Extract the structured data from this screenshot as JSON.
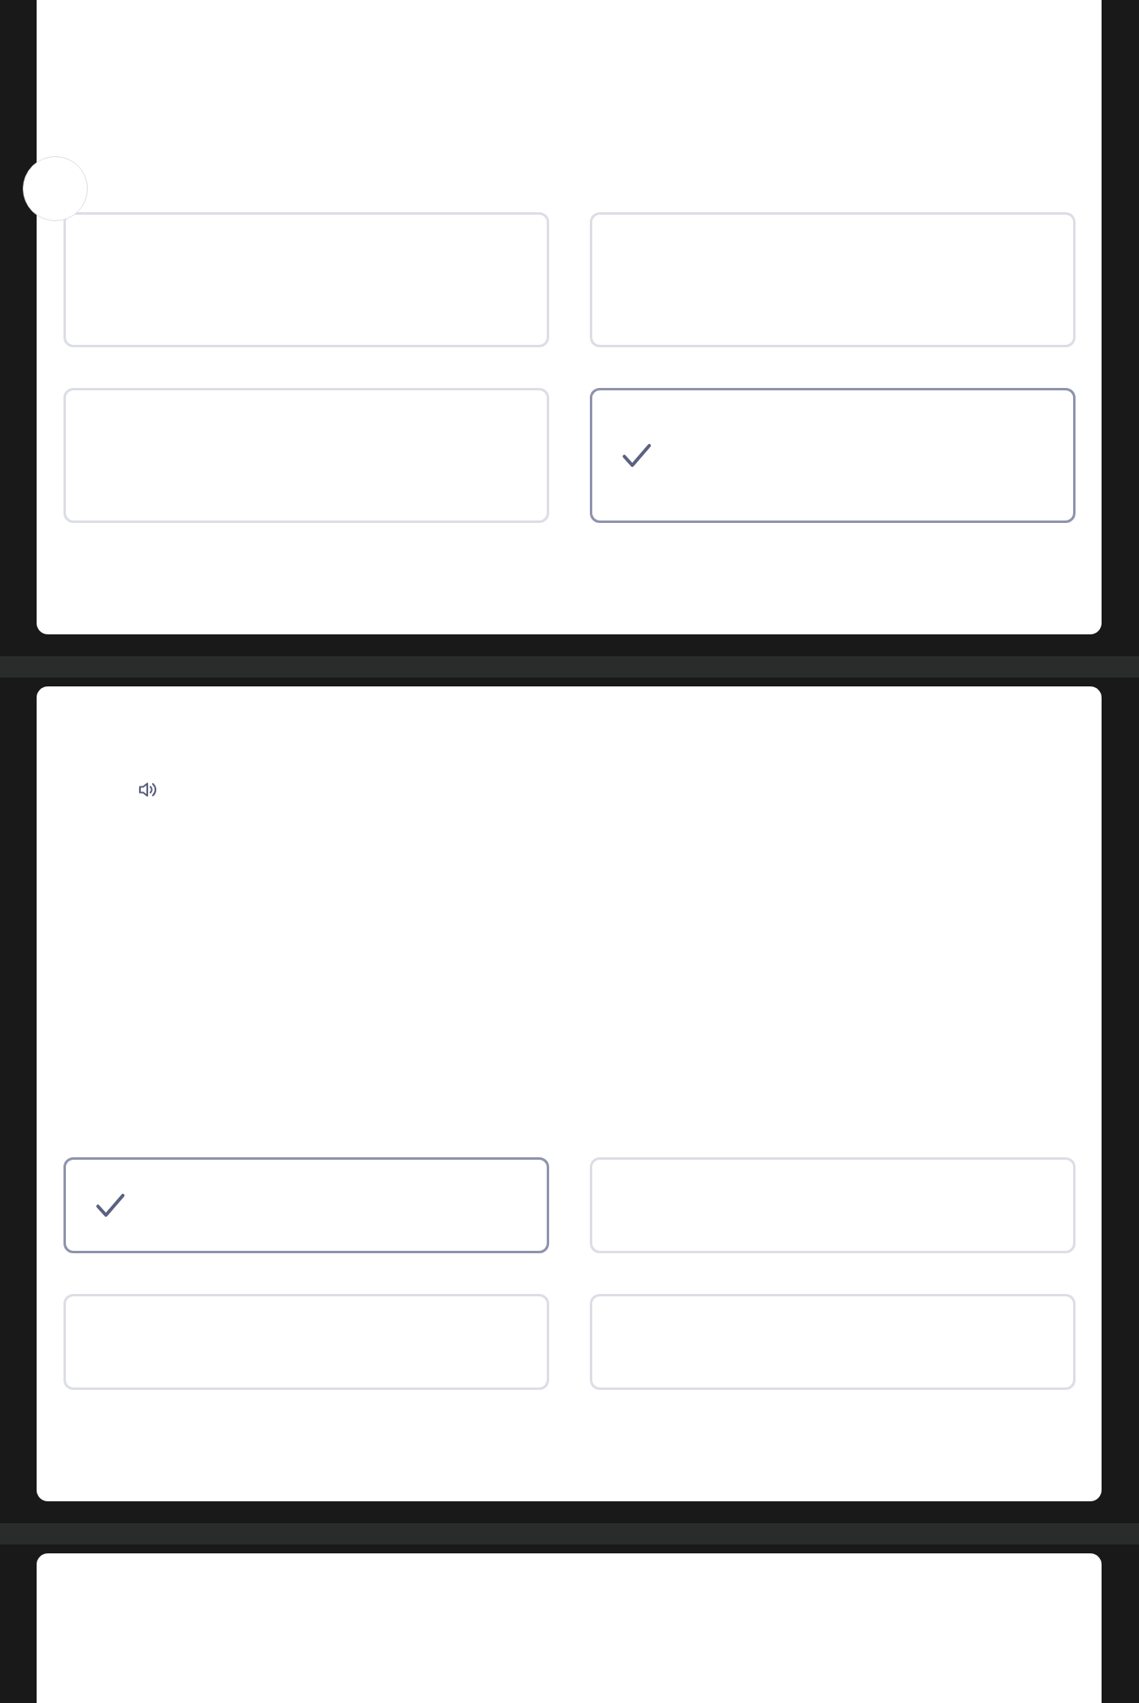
{
  "questions": [
    {
      "kind": "plain",
      "options": [
        {
          "selected": false
        },
        {
          "selected": false
        },
        {
          "selected": false
        },
        {
          "selected": true
        }
      ]
    },
    {
      "kind": "audio",
      "options": [
        {
          "selected": true
        },
        {
          "selected": false
        },
        {
          "selected": false
        },
        {
          "selected": false
        }
      ]
    }
  ]
}
